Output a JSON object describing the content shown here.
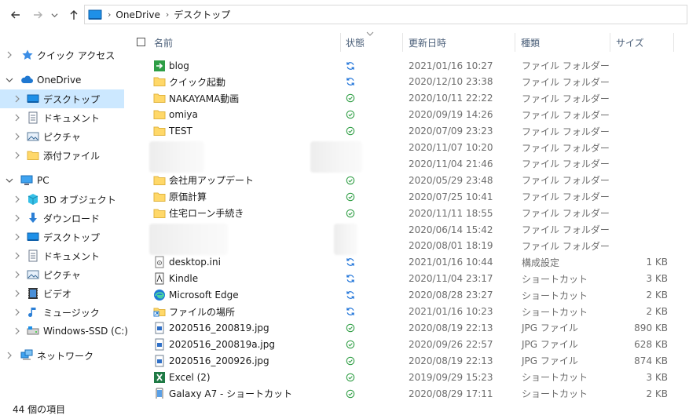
{
  "address": {
    "crumbs": [
      "OneDrive",
      "デスクトップ"
    ],
    "separator": "›"
  },
  "nav": {
    "items": [
      {
        "label": "クイック アクセス",
        "icon": "star-icon"
      },
      {
        "label": "OneDrive",
        "icon": "cloud-icon"
      },
      {
        "label": "デスクトップ",
        "icon": "desktop-icon"
      },
      {
        "label": "ドキュメント",
        "icon": "document-icon"
      },
      {
        "label": "ピクチャ",
        "icon": "picture-icon"
      },
      {
        "label": "添付ファイル",
        "icon": "folder-icon"
      },
      {
        "label": "PC",
        "icon": "pc-icon"
      },
      {
        "label": "3D オブジェクト",
        "icon": "cube-icon"
      },
      {
        "label": "ダウンロード",
        "icon": "download-icon"
      },
      {
        "label": "デスクトップ",
        "icon": "desktop-icon"
      },
      {
        "label": "ドキュメント",
        "icon": "document-icon"
      },
      {
        "label": "ピクチャ",
        "icon": "picture-icon"
      },
      {
        "label": "ビデオ",
        "icon": "video-icon"
      },
      {
        "label": "ミュージック",
        "icon": "music-icon"
      },
      {
        "label": "Windows-SSD (C:)",
        "icon": "drive-icon"
      },
      {
        "label": "ネットワーク",
        "icon": "network-icon"
      }
    ]
  },
  "columns": {
    "name": "名前",
    "status": "状態",
    "modified": "更新日時",
    "type": "種類",
    "size": "サイズ"
  },
  "files": [
    {
      "name": "blog",
      "icon": "shortcut-folder-icon",
      "status": "sync",
      "date": "2021/01/16 10:27",
      "type": "ファイル フォルダー",
      "size": ""
    },
    {
      "name": "クイック起動",
      "icon": "folder-icon",
      "status": "sync",
      "date": "2020/12/10 23:38",
      "type": "ファイル フォルダー",
      "size": ""
    },
    {
      "name": "NAKAYAMA動画",
      "icon": "folder-icon",
      "status": "ok",
      "date": "2020/10/11 22:22",
      "type": "ファイル フォルダー",
      "size": ""
    },
    {
      "name": "omiya",
      "icon": "folder-icon",
      "status": "ok",
      "date": "2020/09/19 14:26",
      "type": "ファイル フォルダー",
      "size": ""
    },
    {
      "name": "TEST",
      "icon": "folder-icon",
      "status": "ok",
      "date": "2020/07/09 23:23",
      "type": "ファイル フォルダー",
      "size": ""
    },
    {
      "name": "",
      "icon": "",
      "status": "",
      "date": "2020/11/07 10:20",
      "type": "ファイル フォルダー",
      "size": ""
    },
    {
      "name": "",
      "icon": "",
      "status": "",
      "date": "2020/11/04 21:46",
      "type": "ファイル フォルダー",
      "size": ""
    },
    {
      "name": "会社用アップデート",
      "icon": "folder-icon",
      "status": "ok",
      "date": "2020/05/29 23:48",
      "type": "ファイル フォルダー",
      "size": ""
    },
    {
      "name": "原価計算",
      "icon": "folder-icon",
      "status": "ok",
      "date": "2020/07/25 10:41",
      "type": "ファイル フォルダー",
      "size": ""
    },
    {
      "name": "住宅ローン手続き",
      "icon": "folder-icon",
      "status": "ok",
      "date": "2020/11/11 18:55",
      "type": "ファイル フォルダー",
      "size": ""
    },
    {
      "name": "",
      "icon": "",
      "status": "",
      "date": "2020/06/14 15:42",
      "type": "ファイル フォルダー",
      "size": ""
    },
    {
      "name": "",
      "icon": "",
      "status": "",
      "date": "2020/08/01 18:19",
      "type": "ファイル フォルダー",
      "size": ""
    },
    {
      "name": "desktop.ini",
      "icon": "settings-file-icon",
      "status": "sync",
      "date": "2021/01/16 10:44",
      "type": "構成設定",
      "size": "1 KB"
    },
    {
      "name": "Kindle",
      "icon": "kindle-icon",
      "status": "sync",
      "date": "2020/11/04 23:17",
      "type": "ショートカット",
      "size": "3 KB"
    },
    {
      "name": "Microsoft Edge",
      "icon": "edge-icon",
      "status": "sync",
      "date": "2020/08/28 23:27",
      "type": "ショートカット",
      "size": "2 KB"
    },
    {
      "name": "ファイルの場所",
      "icon": "file-location-icon",
      "status": "sync",
      "date": "2021/01/16 10:23",
      "type": "ショートカット",
      "size": "2 KB"
    },
    {
      "name": "2020516_200819.jpg",
      "icon": "image-file-icon",
      "status": "ok",
      "date": "2020/08/19 22:13",
      "type": "JPG ファイル",
      "size": "890 KB"
    },
    {
      "name": "2020516_200819a.jpg",
      "icon": "image-file-icon",
      "status": "ok",
      "date": "2020/09/26 22:57",
      "type": "JPG ファイル",
      "size": "628 KB"
    },
    {
      "name": "2020516_200926.jpg",
      "icon": "image-file-icon",
      "status": "ok",
      "date": "2020/08/19 22:13",
      "type": "JPG ファイル",
      "size": "874 KB"
    },
    {
      "name": "Excel (2)",
      "icon": "excel-icon",
      "status": "ok",
      "date": "2019/09/29 15:23",
      "type": "ショートカット",
      "size": "3 KB"
    },
    {
      "name": "Galaxy A7 - ショートカット",
      "icon": "phone-shortcut-icon",
      "status": "ok",
      "date": "2020/08/29 17:11",
      "type": "ショートカット",
      "size": "2 KB"
    }
  ],
  "status_bar": {
    "count_text": "44 個の項目"
  },
  "colors": {
    "selection": "#cce8ff",
    "folder": "#ffd869",
    "sync": "#1e73d9",
    "ok": "#2f9e44",
    "header_text": "#4c607a"
  }
}
